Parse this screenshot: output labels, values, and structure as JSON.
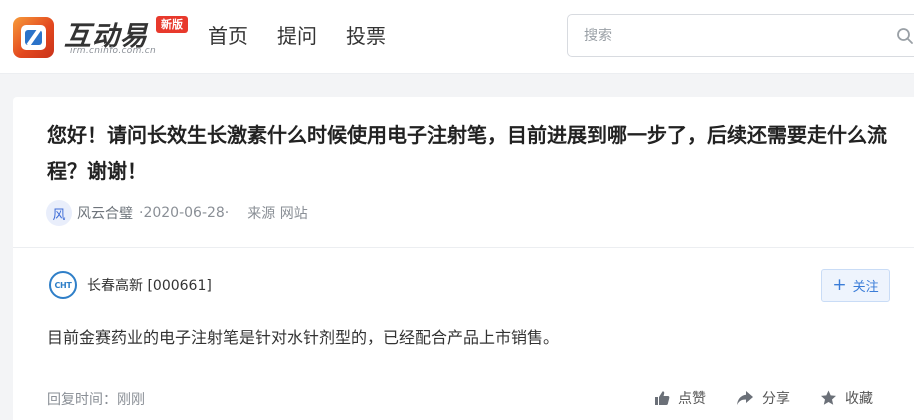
{
  "header": {
    "logo": {
      "title": "互动易",
      "subtitle": "irm.cninfo.com.cn",
      "badge": "新版"
    },
    "nav": [
      "首页",
      "提问",
      "投票"
    ],
    "search": {
      "placeholder": "搜索",
      "value": ""
    }
  },
  "question": {
    "text": "您好！请问长效生长激素什么时候使用电子注射笔，目前进展到哪一步了，后续还需要走什么流程？谢谢！",
    "avatar_char": "风",
    "author": "风云合璧",
    "date": "·2020-06-28·",
    "source": "来源 网站"
  },
  "answer": {
    "company_logo_text": "CHT",
    "company": "长春高新 [000661]",
    "follow_label": "关注",
    "text": "目前金赛药业的电子注射笔是针对水针剂型的，已经配合产品上市销售。",
    "reply_time": "回复时间：刚刚",
    "actions": {
      "like": "点赞",
      "share": "分享",
      "favorite": "收藏"
    }
  },
  "colors": {
    "accent": "#3b7dd8",
    "logo_orange": "#e3491f",
    "badge_red": "#e8392c"
  }
}
